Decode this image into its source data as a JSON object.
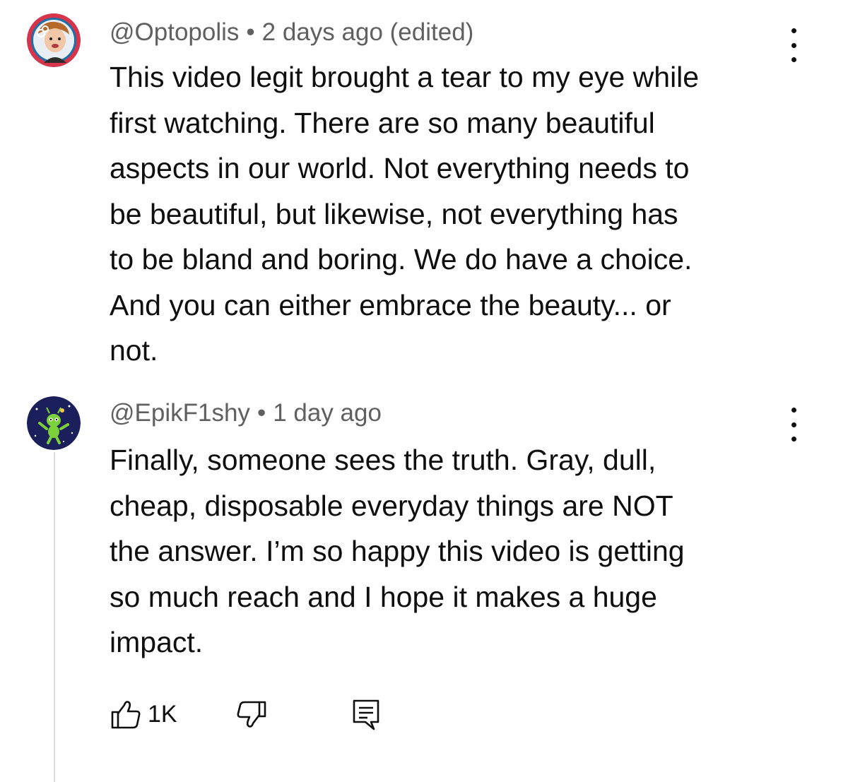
{
  "comments": [
    {
      "handle": "@Optopolis",
      "separator": "•",
      "time": "2 days ago (edited)",
      "text": "This video legit brought a tear to my eye while\nfirst watching. There are so many beautiful\naspects in our world. Not everything needs to\nbe beautiful, but likewise, not everything has\nto be bland and boring. We do have a choice.\nAnd you can either embrace the beauty... or\nnot.",
      "avatar": "person-avatar",
      "menu_icon": "more-vertical-icon"
    },
    {
      "handle": "@EpikF1shy",
      "separator": "•",
      "time": "1 day ago",
      "text": "Finally, someone sees the truth. Gray, dull,\ncheap, disposable everyday things are NOT\nthe answer. I’m so happy this video is getting\nso much reach and I hope it makes a huge\nimpact.",
      "avatar": "alien-space-avatar",
      "menu_icon": "more-vertical-icon",
      "actions": {
        "like_icon": "thumbs-up-icon",
        "like_count": "1K",
        "dislike_icon": "thumbs-down-icon",
        "reply_icon": "reply-comment-icon"
      }
    }
  ],
  "colors": {
    "text_primary": "#0f0f0f",
    "text_secondary": "#606060",
    "thread_line": "#dcdcdc",
    "avatar1_ring": "#d8344a",
    "avatar2_bg": "#1b1f5c"
  }
}
